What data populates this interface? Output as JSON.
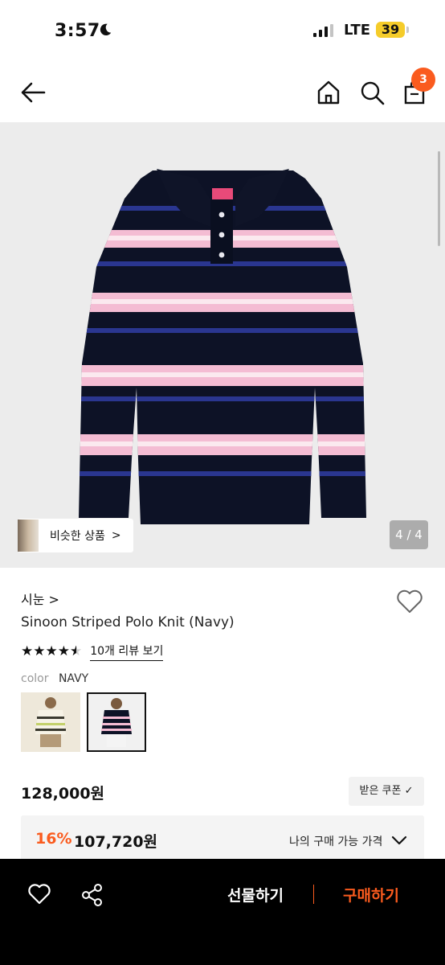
{
  "status": {
    "time": "3:57",
    "network": "LTE",
    "battery": "39"
  },
  "nav": {
    "cart_count": "3"
  },
  "gallery": {
    "similar_label": "비슷한 상품",
    "counter": "4 / 4"
  },
  "product": {
    "brand": "시눈",
    "name": "Sinoon Striped Polo Knit (Navy)",
    "rating_stars": 4.5,
    "review_link": "10개 리뷰 보기",
    "color_key": "color",
    "color_value": "NAVY",
    "swatches": [
      "cream-stripe",
      "navy-stripe"
    ],
    "selected_swatch": 1
  },
  "pricing": {
    "price": "128,000원",
    "coupon_label": "받은 쿠폰 ✓",
    "discount": "16%",
    "sale_price": "107,720원",
    "my_price_label": "나의 구매 가능 가격"
  },
  "bottom_bar": {
    "gift_label": "선물하기",
    "buy_label": "구매하기"
  },
  "colors": {
    "accent": "#fa5b1e",
    "navy": "#0d1226",
    "pink": "#f4bcd3",
    "stripe_blue": "#2a3690"
  }
}
